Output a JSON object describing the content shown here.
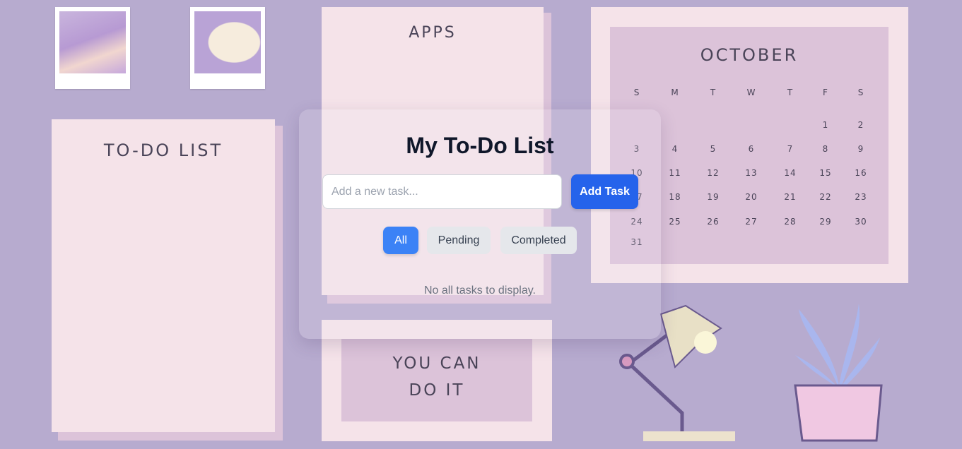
{
  "background": {
    "todo_paper_title": "TO-DO LIST",
    "apps_paper_title": "APPS",
    "motivation_line1": "YOU CAN",
    "motivation_line2": "DO IT",
    "calendar": {
      "month": "OCTOBER",
      "weekdays": [
        "S",
        "M",
        "T",
        "W",
        "T",
        "F",
        "S"
      ],
      "weeks": [
        [
          "",
          "",
          "",
          "",
          "",
          "1",
          "2"
        ],
        [
          "3",
          "4",
          "5",
          "6",
          "7",
          "8",
          "9"
        ],
        [
          "10",
          "11",
          "12",
          "13",
          "14",
          "15",
          "16"
        ],
        [
          "17",
          "18",
          "19",
          "20",
          "21",
          "22",
          "23"
        ],
        [
          "24",
          "25",
          "26",
          "27",
          "28",
          "29",
          "30"
        ],
        [
          "31",
          "",
          "",
          "",
          "",
          "",
          ""
        ]
      ]
    }
  },
  "app": {
    "title": "My To-Do List",
    "task_input": {
      "value": "",
      "placeholder": "Add a new task..."
    },
    "add_button": "Add Task",
    "filters": [
      {
        "label": "All",
        "active": true
      },
      {
        "label": "Pending",
        "active": false
      },
      {
        "label": "Completed",
        "active": false
      }
    ],
    "empty_message": "No all tasks to display."
  },
  "colors": {
    "background": "#b7abcf",
    "primary": "#2563eb",
    "active_filter": "#3b82f6",
    "filter_bg": "#e5e7eb"
  }
}
